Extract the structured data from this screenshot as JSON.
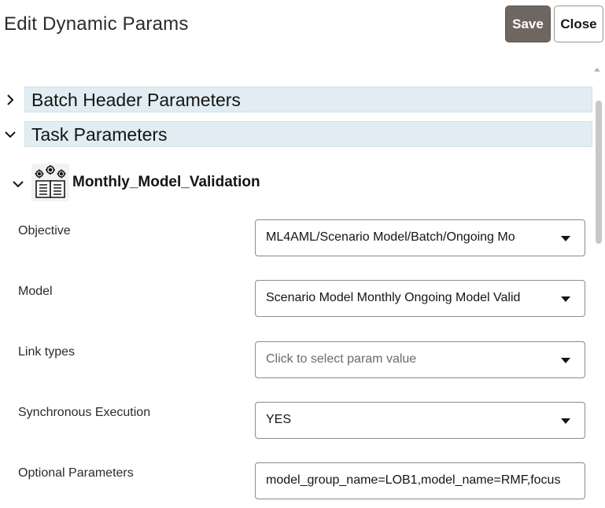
{
  "header": {
    "title": "Edit Dynamic Params",
    "save_label": "Save",
    "close_label": "Close"
  },
  "sections": {
    "batch_header": {
      "label": "Batch Header Parameters",
      "expanded": false
    },
    "task_params": {
      "label": "Task Parameters",
      "expanded": true
    }
  },
  "task": {
    "name": "Monthly_Model_Validation",
    "icon": "gears-book-icon",
    "params": [
      {
        "label": "Objective",
        "value": "ML4AML/Scenario Model/Batch/Ongoing Mo",
        "placeholder": ""
      },
      {
        "label": "Model",
        "value": "Scenario Model Monthly Ongoing Model Valid",
        "placeholder": ""
      },
      {
        "label": "Link types",
        "value": "",
        "placeholder": "Click to select param value"
      },
      {
        "label": "Synchronous Execution",
        "value": "YES",
        "placeholder": ""
      },
      {
        "label": "Optional Parameters",
        "value": "model_group_name=LOB1,model_name=RMF,focus",
        "placeholder": ""
      }
    ]
  },
  "colors": {
    "save_bg": "#6e6660",
    "section_bg": "#e1edf3",
    "field_border": "#8f8b87"
  }
}
